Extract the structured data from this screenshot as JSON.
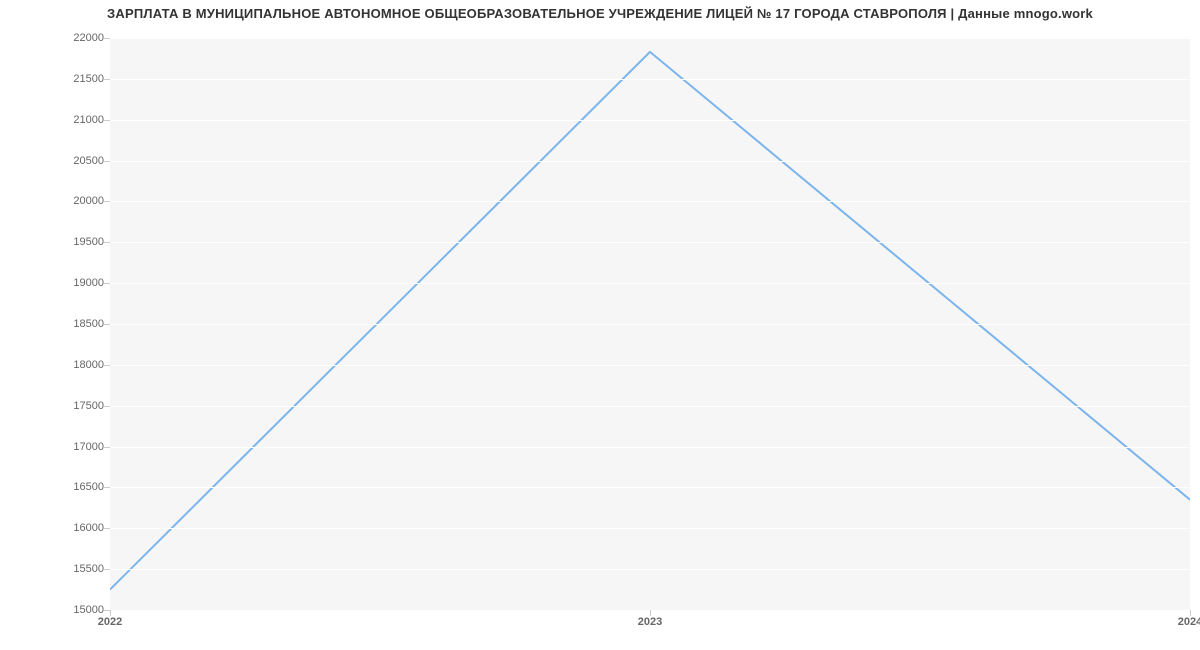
{
  "chart_data": {
    "type": "line",
    "title": "ЗАРПЛАТА В МУНИЦИПАЛЬНОЕ АВТОНОМНОЕ ОБЩЕОБРАЗОВАТЕЛЬНОЕ УЧРЕЖДЕНИЕ ЛИЦЕЙ № 17 ГОРОДА СТАВРОПОЛЯ | Данные mnogo.work",
    "x": [
      2022,
      2023,
      2024
    ],
    "values": [
      15250,
      21830,
      16350
    ],
    "xlabel": "",
    "ylabel": "",
    "ylim": [
      15000,
      22000
    ],
    "y_ticks": [
      15000,
      15500,
      16000,
      16500,
      17000,
      17500,
      18000,
      18500,
      19000,
      19500,
      20000,
      20500,
      21000,
      21500,
      22000
    ],
    "x_ticks": [
      2022,
      2023,
      2024
    ],
    "line_color": "#7cb5ec"
  }
}
